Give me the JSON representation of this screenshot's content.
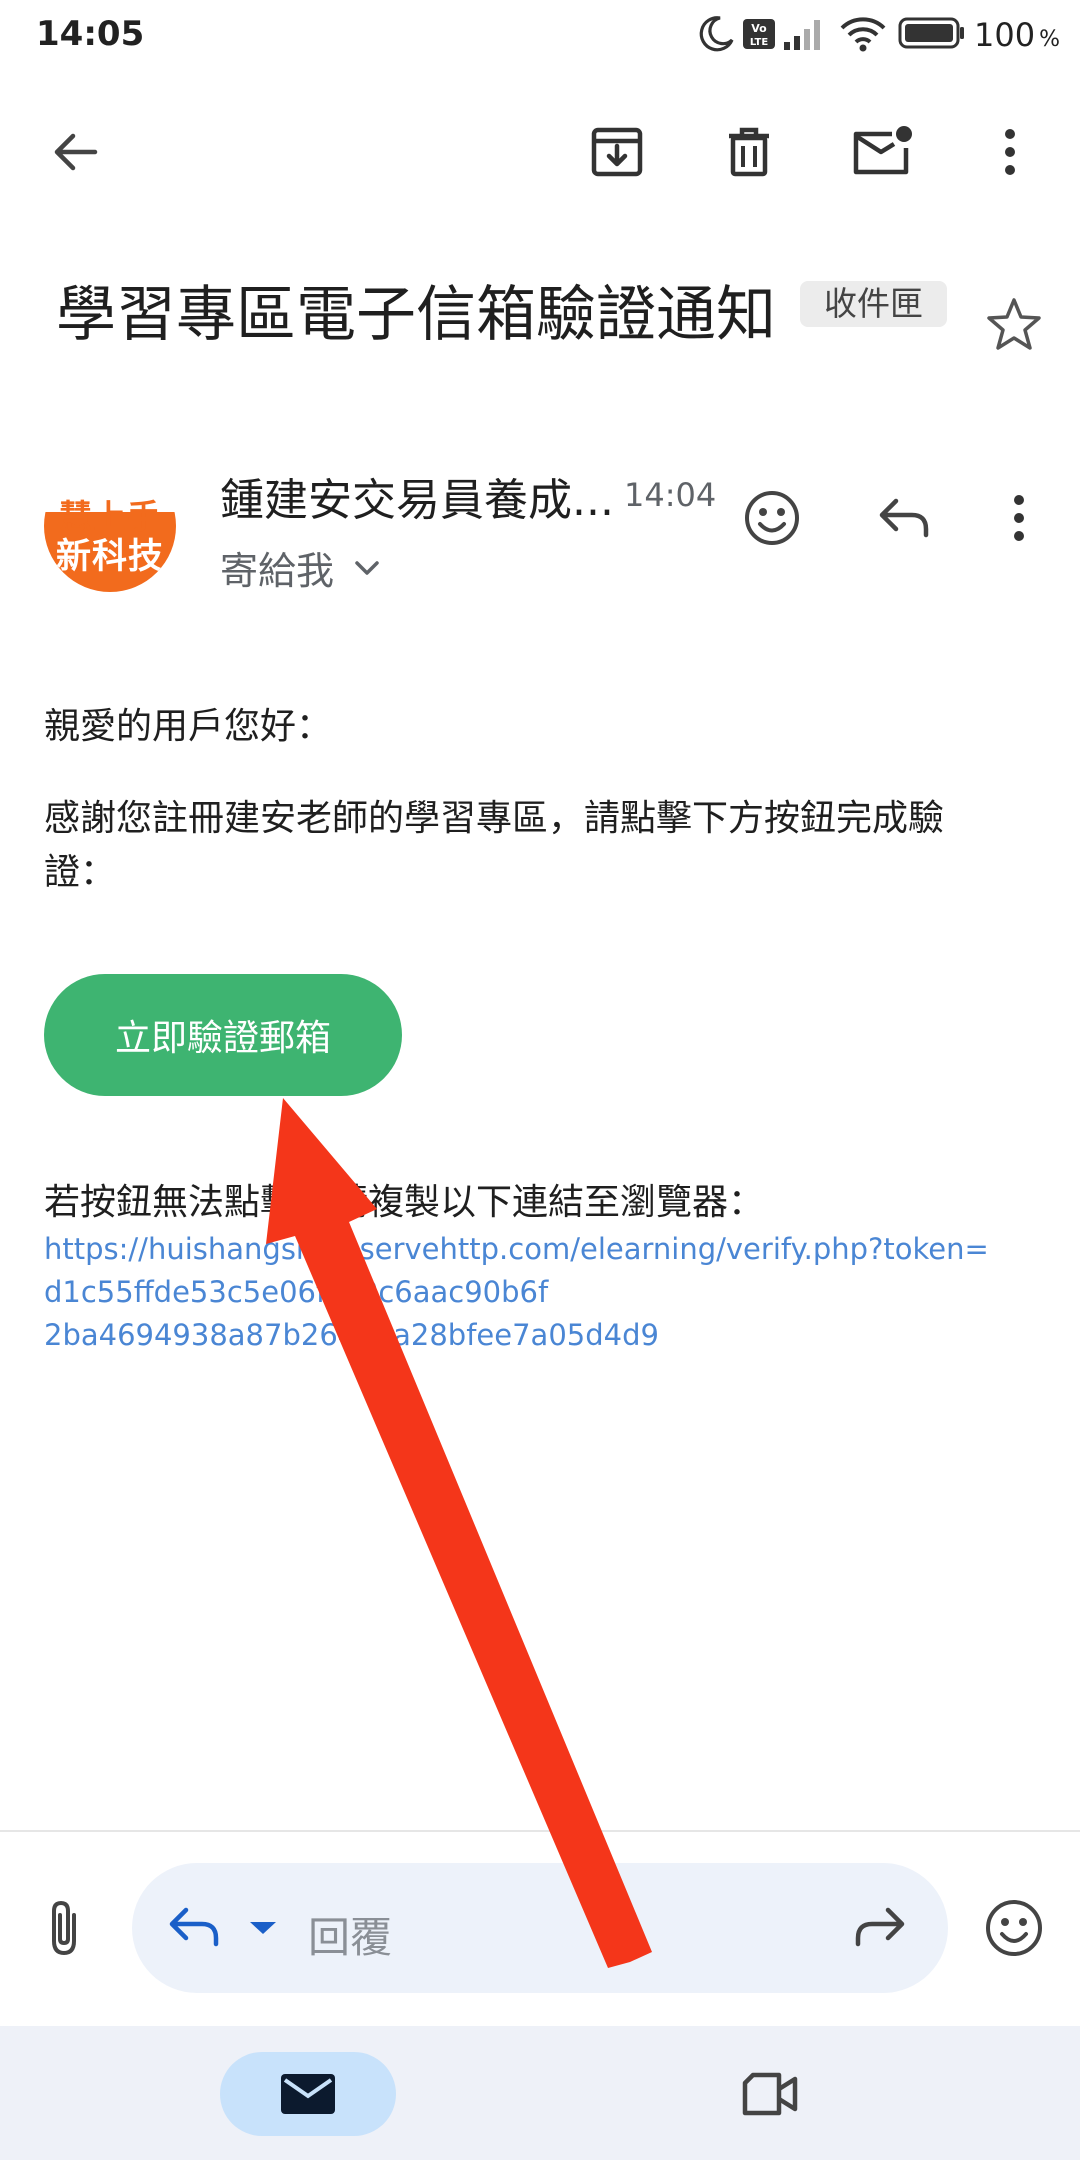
{
  "status_bar": {
    "time": "14:05",
    "battery_percent": "100",
    "battery_unit": "%",
    "icons": [
      "moon-icon",
      "volte-icon",
      "signal-icon",
      "wifi-icon",
      "battery-icon"
    ]
  },
  "toolbar": {
    "icons": [
      "back-arrow-icon",
      "archive-icon",
      "trash-icon",
      "mark-unread-icon",
      "more-vert-icon"
    ]
  },
  "email": {
    "subject": "學習專區電子信箱驗證通知",
    "label": "收件匣",
    "sender": {
      "avatar_line1": "慧上手",
      "avatar_line2": "新科技",
      "name": "鍾建安交易員養成...",
      "time": "14:04",
      "recipient": "寄給我"
    },
    "body": {
      "greeting": "親愛的用戶您好：",
      "intro_line1": "感謝您註冊建安老師的學習專區，請點擊下方按鈕完成驗",
      "intro_line2": "證：",
      "button_label": "立即驗證郵箱",
      "fallback_text": "若按鈕無法點擊，請複製以下連結至瀏覽器：",
      "link_line1": "https://huishangshou.servehttp.com/elearning/verify.php?token=",
      "link_line2": "d1c55ffde53c5e06fca0c6aac90b6f",
      "link_line3": "2ba4694938a87b26493a28bfee7a05d4d9"
    }
  },
  "reply_bar": {
    "placeholder": "回覆"
  },
  "colors": {
    "verify_button": "#3eb471",
    "link": "#4a86d4",
    "annotation_arrow": "#f4361a",
    "nav_active": "#c8e2fb"
  }
}
